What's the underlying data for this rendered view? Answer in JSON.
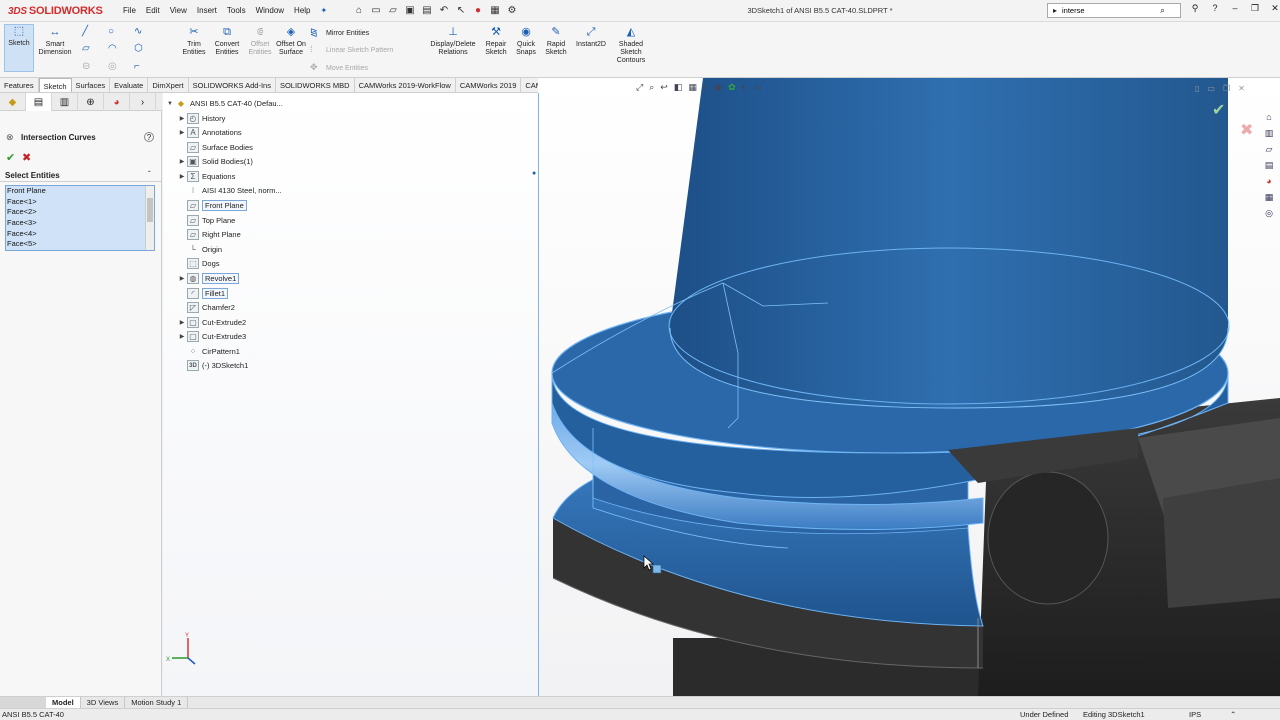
{
  "app": {
    "brand": "SOLIDWORKS",
    "doc_title": "3DSketch1 of ANSI B5.5 CAT-40.SLDPRT *"
  },
  "menu": [
    "File",
    "Edit",
    "View",
    "Insert",
    "Tools",
    "Window",
    "Help"
  ],
  "search": {
    "value": "interse"
  },
  "ribbon": {
    "sketch": "Sketch",
    "smart_dimension": "Smart Dimension",
    "trim_entities": "Trim Entities",
    "convert_entities": "Convert Entities",
    "offset_entities": "Offset Entities",
    "offset_on_surface": "Offset On Surface",
    "mirror_entities": "Mirror Entities",
    "linear_sketch_pattern": "Linear Sketch Pattern",
    "move_entities": "Move Entities",
    "display_delete_relations": "Display/Delete Relations",
    "repair_sketch": "Repair Sketch",
    "quick_snaps": "Quick Snaps",
    "rapid_sketch": "Rapid Sketch",
    "instant2d": "Instant2D",
    "shaded_sketch_contours": "Shaded Sketch Contours"
  },
  "cmd_tabs": [
    "Features",
    "Sketch",
    "Surfaces",
    "Evaluate",
    "DimXpert",
    "SOLIDWORKS Add-Ins",
    "SOLIDWORKS MBD",
    "CAMWorks 2019-WorkFlow",
    "CAMWorks 2019",
    "CAMWorks TBM"
  ],
  "property_manager": {
    "title": "Intersection Curves",
    "section": "Select Entities",
    "entities": [
      "Front Plane",
      "Face<1>",
      "Face<2>",
      "Face<3>",
      "Face<4>",
      "Face<5>"
    ]
  },
  "tree": {
    "root": "ANSI B5.5 CAT-40  (Defau...",
    "items": [
      "History",
      "Annotations",
      "Surface Bodies",
      "Solid Bodies(1)",
      "Equations",
      "AISI 4130 Steel, norm...",
      "Front Plane",
      "Top Plane",
      "Right Plane",
      "Origin",
      "Dogs",
      "Revolve1",
      "Fillet1",
      "Chamfer2",
      "Cut-Extrude2",
      "Cut-Extrude3",
      "CirPattern1",
      "(-) 3DSketch1"
    ]
  },
  "bottom_tabs": [
    "Model",
    "3D Views",
    "Motion Study 1"
  ],
  "status": {
    "file": "ANSI B5.5 CAT-40",
    "state": "Under Defined",
    "mode": "Editing 3DSketch1",
    "units": "IPS"
  },
  "colors": {
    "accent": "#1a5fb4",
    "selection": "#cfe2f7",
    "part_blue": "#2f6fb0",
    "part_dark": "#2a2a2a"
  }
}
